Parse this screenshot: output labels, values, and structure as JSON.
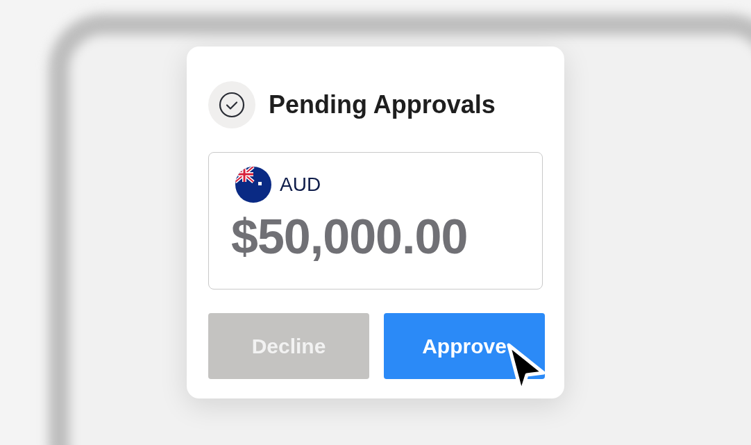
{
  "card": {
    "title": "Pending Approvals",
    "currency": "AUD",
    "amount": "$50,000.00"
  },
  "buttons": [
    {
      "label": "Decline",
      "kind": "secondary"
    },
    {
      "label": "Approve",
      "kind": "primary"
    }
  ]
}
